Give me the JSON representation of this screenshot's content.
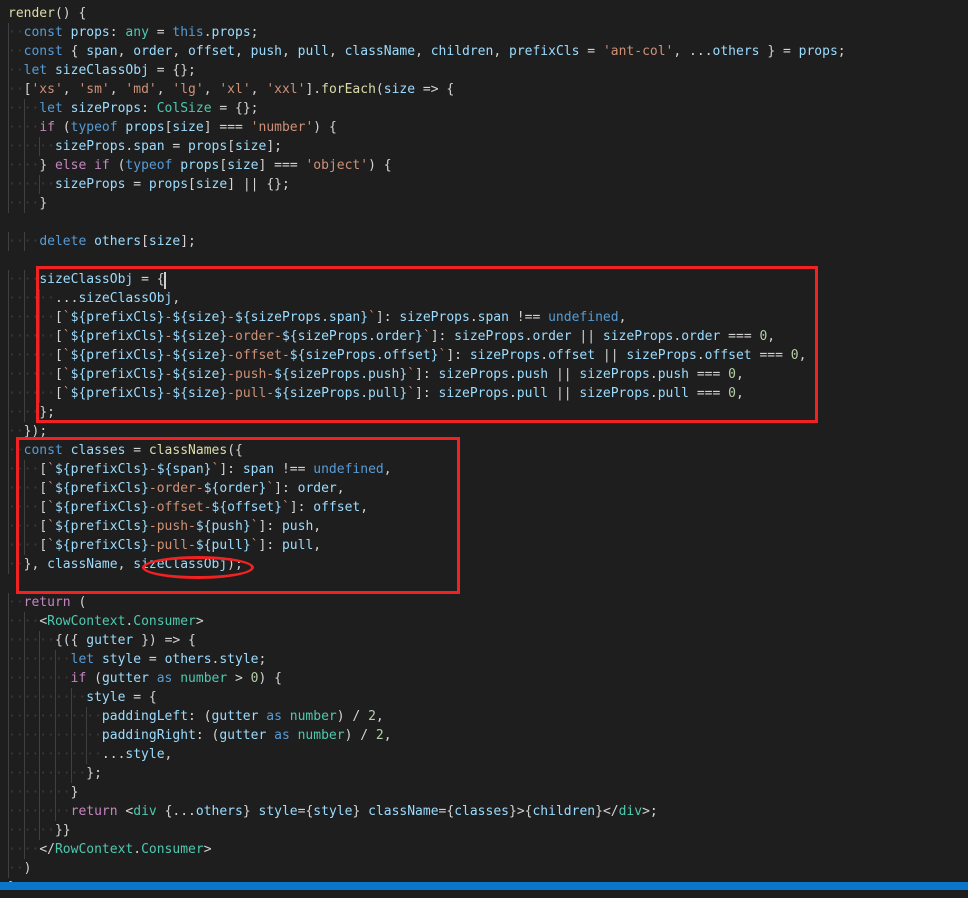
{
  "editor": {
    "theme": "dark-plus",
    "background": "#1e1e1e",
    "font_size_px": 13,
    "line_height_px": 19,
    "statusbar_color": "#0b76c9",
    "annotation_color": "#f22222",
    "indent_guide_color": "#404040"
  },
  "annotations": {
    "box1_label": "sizeClassObj-assignment-highlight",
    "box2_label": "classnames-call-highlight",
    "ellipse_label": "sizeClassObj-argument-highlight"
  },
  "code": {
    "lines": [
      "render() {",
      "  const props: any = this.props;",
      "  const { span, order, offset, push, pull, className, children, prefixCls = 'ant-col', ...others } = props;",
      "  let sizeClassObj = {};",
      "  ['xs', 'sm', 'md', 'lg', 'xl', 'xxl'].forEach(size => {",
      "    let sizeProps: ColSize = {};",
      "    if (typeof props[size] === 'number') {",
      "      sizeProps.span = props[size];",
      "    } else if (typeof props[size] === 'object') {",
      "      sizeProps = props[size] || {};",
      "    }",
      "",
      "    delete others[size];",
      "",
      "    sizeClassObj = {",
      "      ...sizeClassObj,",
      "      [`${prefixCls}-${size}-${sizeProps.span}`]: sizeProps.span !== undefined,",
      "      [`${prefixCls}-${size}-order-${sizeProps.order}`]: sizeProps.order || sizeProps.order === 0,",
      "      [`${prefixCls}-${size}-offset-${sizeProps.offset}`]: sizeProps.offset || sizeProps.offset === 0,",
      "      [`${prefixCls}-${size}-push-${sizeProps.push}`]: sizeProps.push || sizeProps.push === 0,",
      "      [`${prefixCls}-${size}-pull-${sizeProps.pull}`]: sizeProps.pull || sizeProps.pull === 0,",
      "    };",
      "  });",
      "  const classes = classNames({",
      "    [`${prefixCls}-${span}`]: span !== undefined,",
      "    [`${prefixCls}-order-${order}`]: order,",
      "    [`${prefixCls}-offset-${offset}`]: offset,",
      "    [`${prefixCls}-push-${push}`]: push,",
      "    [`${prefixCls}-pull-${pull}`]: pull,",
      "  }, className, sizeClassObj);",
      "",
      "  return (",
      "    <RowContext.Consumer>",
      "      {({ gutter }) => {",
      "        let style = others.style;",
      "        if (gutter as number > 0) {",
      "          style = {",
      "            paddingLeft: (gutter as number) / 2,",
      "            paddingRight: (gutter as number) / 2,",
      "            ...style,",
      "          };",
      "        }",
      "        return <div {...others} style={style} className={classes}>{children}</div>;",
      "      }}",
      "    </RowContext.Consumer>",
      "  )",
      "}"
    ]
  }
}
